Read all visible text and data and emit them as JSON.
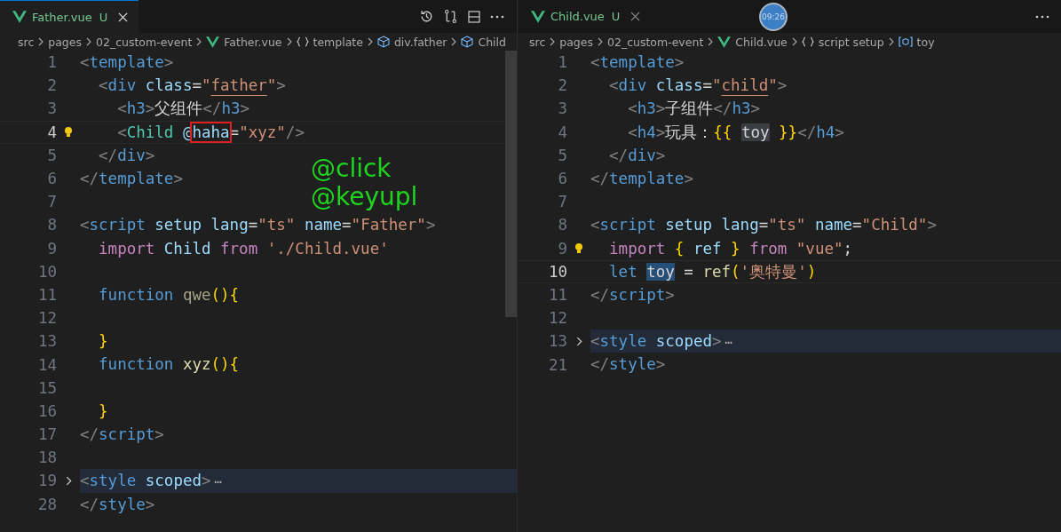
{
  "panes": [
    {
      "tab": {
        "label": "Father.vue",
        "status": "U",
        "selected": true
      },
      "breadcrumbs": [
        {
          "label": "src",
          "kind": "path"
        },
        {
          "label": "pages",
          "kind": "path"
        },
        {
          "label": "02_custom-event",
          "kind": "path"
        },
        {
          "label": "Father.vue",
          "kind": "file"
        },
        {
          "label": "template",
          "kind": "section"
        },
        {
          "label": "div.father",
          "kind": "element"
        },
        {
          "label": "Child",
          "kind": "element"
        }
      ],
      "lines": [
        {
          "number": "1",
          "current": false,
          "lightbulb": false,
          "folded": false,
          "tokens": [
            {
              "text": "<",
              "kind": "punct"
            },
            {
              "text": "template",
              "kind": "tag"
            },
            {
              "text": ">",
              "kind": "punct"
            }
          ]
        },
        {
          "number": "2",
          "current": false,
          "lightbulb": false,
          "folded": false,
          "tokens": [
            {
              "text": "  <",
              "kind": "punct"
            },
            {
              "text": "div",
              "kind": "tag"
            },
            {
              "text": " class",
              "kind": "attr"
            },
            {
              "text": "=",
              "kind": "text"
            },
            {
              "text": "\"",
              "kind": "string"
            },
            {
              "text": "father",
              "kind": "link"
            },
            {
              "text": "\"",
              "kind": "string"
            },
            {
              "text": ">",
              "kind": "punct"
            }
          ]
        },
        {
          "number": "3",
          "current": false,
          "lightbulb": false,
          "folded": false,
          "tokens": [
            {
              "text": "    <",
              "kind": "punct"
            },
            {
              "text": "h3",
              "kind": "tag"
            },
            {
              "text": ">",
              "kind": "punct"
            },
            {
              "text": "父组件",
              "kind": "text"
            },
            {
              "text": "</",
              "kind": "punct"
            },
            {
              "text": "h3",
              "kind": "tag"
            },
            {
              "text": ">",
              "kind": "punct"
            }
          ]
        },
        {
          "number": "4",
          "current": true,
          "lightbulb": true,
          "folded": false,
          "tokens": [
            {
              "text": "    <",
              "kind": "punct"
            },
            {
              "text": "Child",
              "kind": "component"
            },
            {
              "text": " @",
              "kind": "attr"
            },
            {
              "text": "haha",
              "kind": "boxed"
            },
            {
              "text": "=",
              "kind": "text"
            },
            {
              "text": "\"xyz\"",
              "kind": "string"
            },
            {
              "text": "/>",
              "kind": "punct"
            }
          ]
        },
        {
          "number": "5",
          "current": false,
          "lightbulb": false,
          "folded": false,
          "tokens": [
            {
              "text": "  </",
              "kind": "punct"
            },
            {
              "text": "div",
              "kind": "tag"
            },
            {
              "text": ">",
              "kind": "punct"
            }
          ]
        },
        {
          "number": "6",
          "current": false,
          "lightbulb": false,
          "folded": false,
          "tokens": [
            {
              "text": "</",
              "kind": "punct"
            },
            {
              "text": "template",
              "kind": "tag"
            },
            {
              "text": ">",
              "kind": "punct"
            }
          ]
        },
        {
          "number": "7",
          "current": false,
          "lightbulb": false,
          "folded": false
        },
        {
          "number": "8",
          "current": false,
          "lightbulb": false,
          "folded": false,
          "tokens": [
            {
              "text": "<",
              "kind": "punct"
            },
            {
              "text": "script",
              "kind": "tag"
            },
            {
              "text": " setup",
              "kind": "attr"
            },
            {
              "text": " lang",
              "kind": "attr"
            },
            {
              "text": "=",
              "kind": "text"
            },
            {
              "text": "\"ts\"",
              "kind": "string"
            },
            {
              "text": " name",
              "kind": "attr"
            },
            {
              "text": "=",
              "kind": "text"
            },
            {
              "text": "\"Father\"",
              "kind": "string"
            },
            {
              "text": ">",
              "kind": "punct"
            }
          ]
        },
        {
          "number": "9",
          "current": false,
          "lightbulb": false,
          "folded": false,
          "tokens": [
            {
              "text": "  import",
              "kind": "keyword"
            },
            {
              "text": " Child",
              "kind": "variable"
            },
            {
              "text": " from",
              "kind": "keyword"
            },
            {
              "text": " './Child.vue'",
              "kind": "string"
            }
          ]
        },
        {
          "number": "10",
          "current": false,
          "lightbulb": false,
          "folded": false
        },
        {
          "number": "11",
          "current": false,
          "lightbulb": false,
          "folded": false,
          "tokens": [
            {
              "text": "  function",
              "kind": "tag"
            },
            {
              "text": " qwe",
              "kind": "unused"
            },
            {
              "text": "(){",
              "kind": "brace"
            }
          ]
        },
        {
          "number": "12",
          "current": false,
          "lightbulb": false,
          "folded": false
        },
        {
          "number": "13",
          "current": false,
          "lightbulb": false,
          "folded": false,
          "tokens": [
            {
              "text": "  }",
              "kind": "brace"
            }
          ]
        },
        {
          "number": "14",
          "current": false,
          "lightbulb": false,
          "folded": false,
          "tokens": [
            {
              "text": "  function",
              "kind": "tag"
            },
            {
              "text": " xyz",
              "kind": "function"
            },
            {
              "text": "(){",
              "kind": "brace"
            }
          ]
        },
        {
          "number": "15",
          "current": false,
          "lightbulb": false,
          "folded": false
        },
        {
          "number": "16",
          "current": false,
          "lightbulb": false,
          "folded": false,
          "tokens": [
            {
              "text": "  }",
              "kind": "brace"
            }
          ]
        },
        {
          "number": "17",
          "current": false,
          "lightbulb": false,
          "folded": false,
          "tokens": [
            {
              "text": "</",
              "kind": "punct"
            },
            {
              "text": "script",
              "kind": "tag"
            },
            {
              "text": ">",
              "kind": "punct"
            }
          ]
        },
        {
          "number": "18",
          "current": false,
          "lightbulb": false,
          "folded": false
        },
        {
          "number": "19",
          "current": false,
          "lightbulb": false,
          "folded": true,
          "tokens": [
            {
              "text": "<",
              "kind": "punct"
            },
            {
              "text": "style",
              "kind": "tag"
            },
            {
              "text": " scoped",
              "kind": "attr"
            },
            {
              "text": ">",
              "kind": "punct"
            },
            {
              "text": "⋯",
              "kind": "ellipsis"
            }
          ]
        },
        {
          "number": "28",
          "current": false,
          "lightbulb": false,
          "folded": false,
          "tokens": [
            {
              "text": "</",
              "kind": "punct"
            },
            {
              "text": "style",
              "kind": "tag"
            },
            {
              "text": ">",
              "kind": "punct"
            }
          ]
        }
      ],
      "annotations": [
        "@click",
        "@keyupl"
      ]
    },
    {
      "tab": {
        "label": "Child.vue",
        "status": "U",
        "selected": false
      },
      "overlay": "09:26",
      "breadcrumbs": [
        {
          "label": "src",
          "kind": "path"
        },
        {
          "label": "pages",
          "kind": "path"
        },
        {
          "label": "02_custom-event",
          "kind": "path"
        },
        {
          "label": "Child.vue",
          "kind": "file"
        },
        {
          "label": "script setup",
          "kind": "section"
        },
        {
          "label": "toy",
          "kind": "variable"
        }
      ],
      "lines": [
        {
          "number": "1",
          "current": false,
          "lightbulb": false,
          "folded": false,
          "tokens": [
            {
              "text": "<",
              "kind": "punct"
            },
            {
              "text": "template",
              "kind": "tag"
            },
            {
              "text": ">",
              "kind": "punct"
            }
          ]
        },
        {
          "number": "2",
          "current": false,
          "lightbulb": false,
          "folded": false,
          "tokens": [
            {
              "text": "  <",
              "kind": "punct"
            },
            {
              "text": "div",
              "kind": "tag"
            },
            {
              "text": " class",
              "kind": "attr"
            },
            {
              "text": "=",
              "kind": "text"
            },
            {
              "text": "\"",
              "kind": "string"
            },
            {
              "text": "child",
              "kind": "link"
            },
            {
              "text": "\"",
              "kind": "string"
            },
            {
              "text": ">",
              "kind": "punct"
            }
          ]
        },
        {
          "number": "3",
          "current": false,
          "lightbulb": false,
          "folded": false,
          "tokens": [
            {
              "text": "    <",
              "kind": "punct"
            },
            {
              "text": "h3",
              "kind": "tag"
            },
            {
              "text": ">",
              "kind": "punct"
            },
            {
              "text": "子组件",
              "kind": "text"
            },
            {
              "text": "</",
              "kind": "punct"
            },
            {
              "text": "h3",
              "kind": "tag"
            },
            {
              "text": ">",
              "kind": "punct"
            }
          ]
        },
        {
          "number": "4",
          "current": false,
          "lightbulb": false,
          "folded": false,
          "tokens": [
            {
              "text": "    <",
              "kind": "punct"
            },
            {
              "text": "h4",
              "kind": "tag"
            },
            {
              "text": ">",
              "kind": "punct"
            },
            {
              "text": "玩具：",
              "kind": "text"
            },
            {
              "text": "{{ ",
              "kind": "brace"
            },
            {
              "text": "toy",
              "kind": "match"
            },
            {
              "text": " }}",
              "kind": "brace"
            },
            {
              "text": "</",
              "kind": "punct"
            },
            {
              "text": "h4",
              "kind": "tag"
            },
            {
              "text": ">",
              "kind": "punct"
            }
          ]
        },
        {
          "number": "5",
          "current": false,
          "lightbulb": false,
          "folded": false,
          "tokens": [
            {
              "text": "  </",
              "kind": "punct"
            },
            {
              "text": "div",
              "kind": "tag"
            },
            {
              "text": ">",
              "kind": "punct"
            }
          ]
        },
        {
          "number": "6",
          "current": false,
          "lightbulb": false,
          "folded": false,
          "tokens": [
            {
              "text": "</",
              "kind": "punct"
            },
            {
              "text": "template",
              "kind": "tag"
            },
            {
              "text": ">",
              "kind": "punct"
            }
          ]
        },
        {
          "number": "7",
          "current": false,
          "lightbulb": false,
          "folded": false
        },
        {
          "number": "8",
          "current": false,
          "lightbulb": false,
          "folded": false,
          "tokens": [
            {
              "text": "<",
              "kind": "punct"
            },
            {
              "text": "script",
              "kind": "tag"
            },
            {
              "text": " setup",
              "kind": "attr"
            },
            {
              "text": " lang",
              "kind": "attr"
            },
            {
              "text": "=",
              "kind": "text"
            },
            {
              "text": "\"ts\"",
              "kind": "string"
            },
            {
              "text": " name",
              "kind": "attr"
            },
            {
              "text": "=",
              "kind": "text"
            },
            {
              "text": "\"Child\"",
              "kind": "string"
            },
            {
              "text": ">",
              "kind": "punct"
            }
          ]
        },
        {
          "number": "9",
          "current": false,
          "lightbulb": true,
          "folded": false,
          "tokens": [
            {
              "text": "  import",
              "kind": "keyword"
            },
            {
              "text": " {",
              "kind": "brace"
            },
            {
              "text": " ref",
              "kind": "variable"
            },
            {
              "text": " }",
              "kind": "brace"
            },
            {
              "text": " from",
              "kind": "keyword"
            },
            {
              "text": " \"vue\"",
              "kind": "string"
            },
            {
              "text": ";",
              "kind": "text"
            }
          ]
        },
        {
          "number": "10",
          "current": true,
          "lightbulb": false,
          "folded": false,
          "tokens": [
            {
              "text": "  let ",
              "kind": "tag"
            },
            {
              "text": "toy",
              "kind": "selection"
            },
            {
              "text": " = ",
              "kind": "text"
            },
            {
              "text": "ref",
              "kind": "function"
            },
            {
              "text": "(",
              "kind": "brace"
            },
            {
              "text": "'奥特曼'",
              "kind": "string"
            },
            {
              "text": ")",
              "kind": "brace"
            }
          ]
        },
        {
          "number": "11",
          "current": false,
          "lightbulb": false,
          "folded": false,
          "tokens": [
            {
              "text": "</",
              "kind": "punct"
            },
            {
              "text": "script",
              "kind": "tag"
            },
            {
              "text": ">",
              "kind": "punct"
            }
          ]
        },
        {
          "number": "12",
          "current": false,
          "lightbulb": false,
          "folded": false
        },
        {
          "number": "13",
          "current": false,
          "lightbulb": false,
          "folded": true,
          "tokens": [
            {
              "text": "<",
              "kind": "punct"
            },
            {
              "text": "style",
              "kind": "tag"
            },
            {
              "text": " scoped",
              "kind": "attr"
            },
            {
              "text": ">",
              "kind": "punct"
            },
            {
              "text": "⋯",
              "kind": "ellipsis"
            }
          ]
        },
        {
          "number": "21",
          "current": false,
          "lightbulb": false,
          "folded": false,
          "tokens": [
            {
              "text": "</",
              "kind": "punct"
            },
            {
              "text": "style",
              "kind": "tag"
            },
            {
              "text": ">",
              "kind": "punct"
            }
          ]
        }
      ]
    }
  ]
}
